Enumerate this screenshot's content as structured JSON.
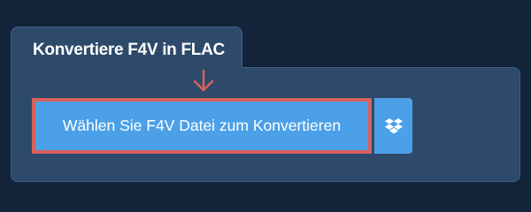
{
  "tab": {
    "title": "Konvertiere F4V in FLAC"
  },
  "upload": {
    "button_label": "Wählen Sie F4V Datei zum Konvertieren",
    "dropbox_icon": "dropbox-icon"
  },
  "colors": {
    "page_background": "#13233a",
    "panel_background": "#2d4a6b",
    "button_background": "#4ca0e8",
    "highlight": "#d9605e"
  }
}
